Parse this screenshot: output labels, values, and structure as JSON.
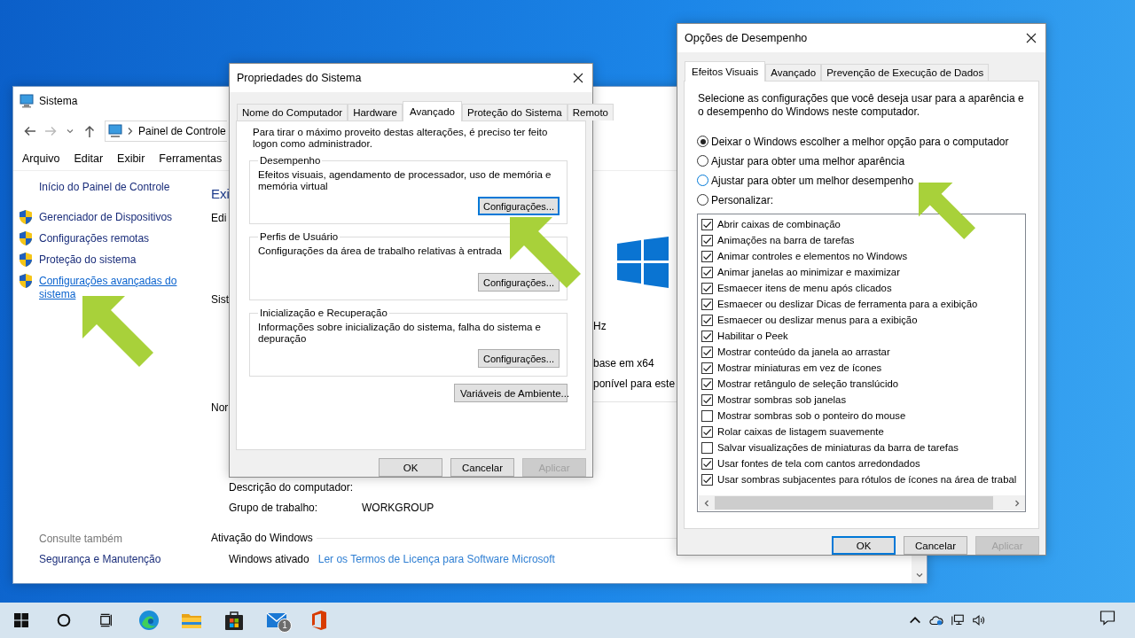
{
  "system_window": {
    "title": "Sistema",
    "address": "Painel de Controle",
    "menu": [
      "Arquivo",
      "Editar",
      "Exibir",
      "Ferramentas"
    ],
    "sidebar": {
      "home": "Início do Painel de Controle",
      "links": [
        {
          "label": "Gerenciador de Dispositivos",
          "hover": false
        },
        {
          "label": "Configurações remotas",
          "hover": false
        },
        {
          "label": "Proteção do sistema",
          "hover": false
        },
        {
          "label": "Configurações avançadas do sistema",
          "hover": true
        }
      ],
      "see_also_heading": "Consulte também",
      "see_also": [
        "Segurança e Manutenção"
      ]
    },
    "main": {
      "heading": "Exi",
      "labels": [
        "Edi",
        "Sist",
        "Nor"
      ],
      "right_texts": [
        "Hz",
        "base em x64",
        "ponível para este"
      ],
      "computer_fields": [
        {
          "label": "Descrição do computador:"
        },
        {
          "label": "Grupo de trabalho:",
          "value": "WORKGROUP"
        }
      ],
      "activation": {
        "heading": "Ativação do Windows",
        "status": "Windows ativado",
        "link": "Ler os Termos de Licença para Software Microsoft"
      }
    }
  },
  "system_properties": {
    "title": "Propriedades do Sistema",
    "tabs": [
      {
        "label": "Nome do Computador",
        "selected": false
      },
      {
        "label": "Hardware",
        "selected": false
      },
      {
        "label": "Avançado",
        "selected": true
      },
      {
        "label": "Proteção do Sistema",
        "selected": false
      },
      {
        "label": "Remoto",
        "selected": false
      }
    ],
    "note": "Para tirar o máximo proveito destas alterações, é preciso ter feito logon como administrador.",
    "groups": [
      {
        "title": "Desempenho",
        "text": "Efeitos visuais, agendamento de processador, uso de memória e memória virtual",
        "button": "Configurações...",
        "focused": true
      },
      {
        "title": "Perfis de Usuário",
        "text": "Configurações da área de trabalho relativas à entrada",
        "button": "Configurações...",
        "focused": false
      },
      {
        "title": "Inicialização e Recuperação",
        "text": "Informações sobre inicialização do sistema, falha do sistema e depuração",
        "button": "Configurações...",
        "focused": false
      }
    ],
    "env_button": "Variáveis de Ambiente...",
    "buttons": [
      {
        "label": "OK",
        "disabled": false,
        "focused": false
      },
      {
        "label": "Cancelar",
        "disabled": false,
        "focused": false
      },
      {
        "label": "Aplicar",
        "disabled": true,
        "focused": false
      }
    ]
  },
  "performance_options": {
    "title": "Opções de Desempenho",
    "tabs": [
      {
        "label": "Efeitos Visuais",
        "selected": true
      },
      {
        "label": "Avançado",
        "selected": false
      },
      {
        "label": "Prevenção de Execução de Dados",
        "selected": false
      }
    ],
    "intro": "Selecione as configurações que você deseja usar para a aparência e o desempenho do Windows neste computador.",
    "radios": [
      {
        "label": "Deixar o Windows escolher a melhor opção para o computador",
        "selected": true,
        "hover": false
      },
      {
        "label": "Ajustar para obter uma melhor aparência",
        "selected": false,
        "hover": false
      },
      {
        "label": "Ajustar para obter um melhor desempenho",
        "selected": false,
        "hover": true
      },
      {
        "label": "Personalizar:",
        "selected": false,
        "hover": false
      }
    ],
    "effects": [
      {
        "label": "Abrir caixas de combinação",
        "checked": true
      },
      {
        "label": "Animações na barra de tarefas",
        "checked": true
      },
      {
        "label": "Animar controles e elementos no Windows",
        "checked": true
      },
      {
        "label": "Animar janelas ao minimizar e maximizar",
        "checked": true
      },
      {
        "label": "Esmaecer itens de menu após clicados",
        "checked": true
      },
      {
        "label": "Esmaecer ou deslizar Dicas de ferramenta para a exibição",
        "checked": true
      },
      {
        "label": "Esmaecer ou deslizar menus para a exibição",
        "checked": true
      },
      {
        "label": "Habilitar o Peek",
        "checked": true
      },
      {
        "label": "Mostrar conteúdo da janela ao arrastar",
        "checked": true
      },
      {
        "label": "Mostrar miniaturas em vez de ícones",
        "checked": true
      },
      {
        "label": "Mostrar retângulo de seleção translúcido",
        "checked": true
      },
      {
        "label": "Mostrar sombras sob janelas",
        "checked": true
      },
      {
        "label": "Mostrar sombras sob o ponteiro do mouse",
        "checked": false
      },
      {
        "label": "Rolar caixas de listagem suavemente",
        "checked": true
      },
      {
        "label": "Salvar visualizações de miniaturas da barra de tarefas",
        "checked": false
      },
      {
        "label": "Usar fontes de tela com cantos arredondados",
        "checked": true
      },
      {
        "label": "Usar sombras subjacentes para rótulos de ícones na área de trabal",
        "checked": true
      }
    ],
    "buttons": [
      {
        "label": "OK",
        "disabled": false,
        "focused": true
      },
      {
        "label": "Cancelar",
        "disabled": false,
        "focused": false
      },
      {
        "label": "Aplicar",
        "disabled": true,
        "focused": false
      }
    ]
  },
  "taskbar": {
    "mail_badge": "1"
  }
}
